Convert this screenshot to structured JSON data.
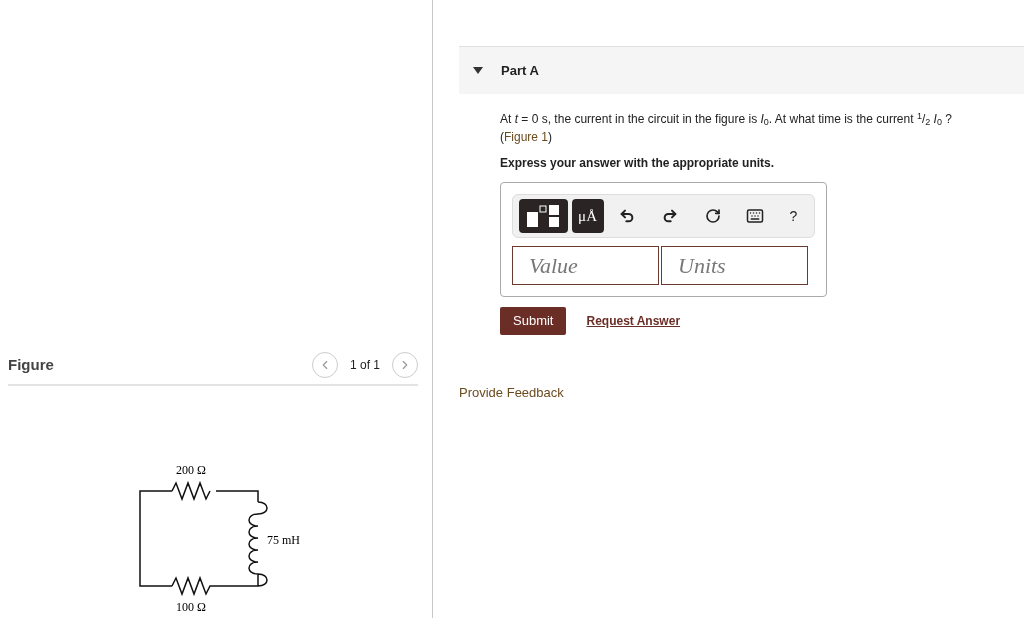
{
  "figure_panel": {
    "title": "Figure",
    "pager": "1 of 1",
    "circuit": {
      "labels": [
        "200 Ω",
        "75 mH",
        "100 Ω"
      ]
    }
  },
  "part": {
    "title": "Part A",
    "expanded": true,
    "question": "At *t* = 0 s, the current in the circuit in the figure is *I*$_{0}$. At what time is the current $^{1}$/$_{2}$ *I*$_{0}$ ?",
    "figure_ref": {
      "open": "(",
      "link": "Figure 1",
      "close": ")"
    },
    "instruction": "Express your answer with the appropriate units.",
    "toolbar": {
      "units_button": "μÅ",
      "help": "?"
    },
    "value_field": {
      "placeholder": "Value"
    },
    "units_field": {
      "placeholder": "Units"
    },
    "buttons": [
      "Submit",
      "Request Answer"
    ]
  },
  "feedback_link": "Provide Feedback"
}
